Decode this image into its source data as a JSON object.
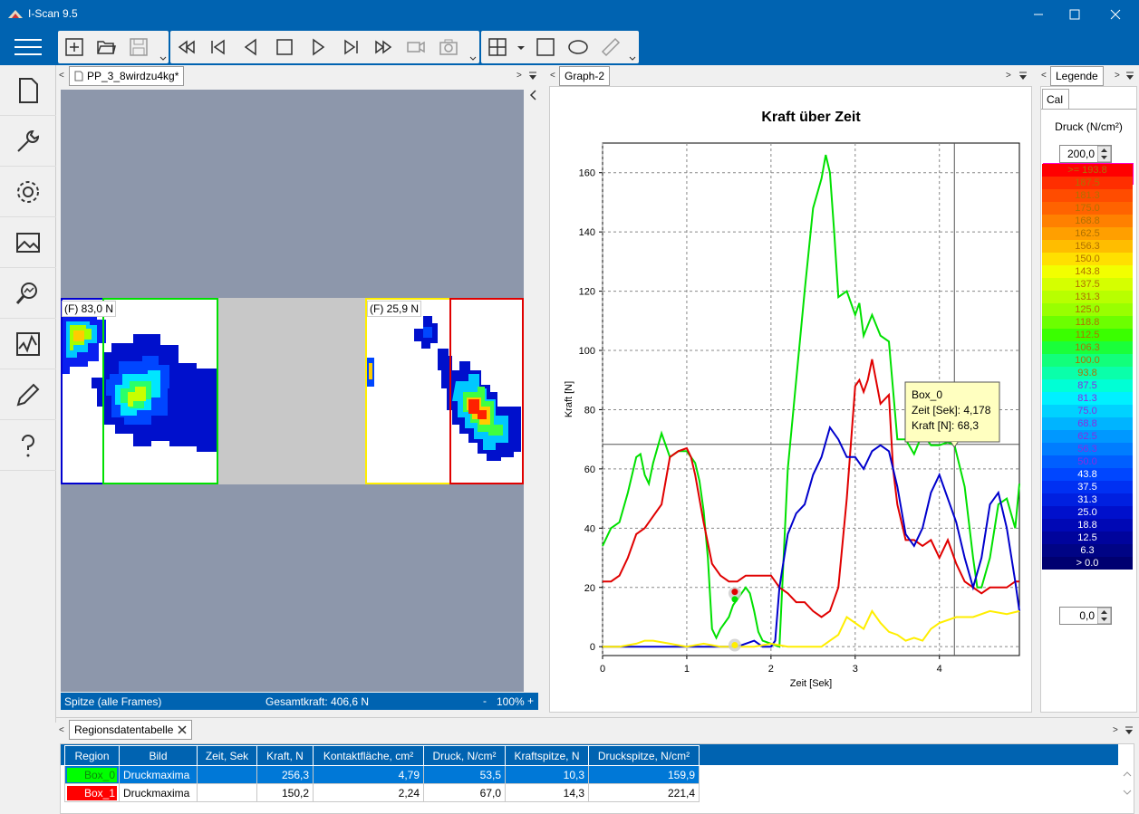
{
  "window": {
    "title": "I-Scan 9.5"
  },
  "left_panel": {
    "tab_label": "PP_3_8wirdzu4kg*",
    "region_left_label": "(F) 83,0 N",
    "region_right_label": "(F) 25,9 N",
    "status_left": "Spitze (alle Frames)",
    "status_center": "Gesamtkraft: 406,6 N",
    "zoom_minus": "-",
    "zoom": "100%",
    "zoom_plus": "+"
  },
  "graph_panel": {
    "tab_label": "Graph-2"
  },
  "legend_panel": {
    "tab_label": "Legende",
    "cal_tab": "Cal",
    "unit_label": "Druck (N/cm²)",
    "max_value": "200,0",
    "min_value": "0,0",
    "scale": [
      {
        "label": ">= 193.8",
        "color": "#ff0000"
      },
      {
        "label": "187.5",
        "color": "#ff2e00"
      },
      {
        "label": "181.3",
        "color": "#ff4c00"
      },
      {
        "label": "175.0",
        "color": "#ff6300"
      },
      {
        "label": "168.8",
        "color": "#ff8000"
      },
      {
        "label": "162.5",
        "color": "#ff9f00"
      },
      {
        "label": "156.3",
        "color": "#ffbd00"
      },
      {
        "label": "150.0",
        "color": "#ffe000"
      },
      {
        "label": "143.8",
        "color": "#f2ff00"
      },
      {
        "label": "137.5",
        "color": "#d5ff00"
      },
      {
        "label": "131.3",
        "color": "#b8ff00"
      },
      {
        "label": "125.0",
        "color": "#99ff00"
      },
      {
        "label": "118.8",
        "color": "#6cff00"
      },
      {
        "label": "112.5",
        "color": "#3aff00"
      },
      {
        "label": "106.3",
        "color": "#1aff3a"
      },
      {
        "label": "100.0",
        "color": "#12ff7b"
      },
      {
        "label": "93.8",
        "color": "#0affaa"
      },
      {
        "label": "87.5",
        "color": "#00ffd5"
      },
      {
        "label": "81.3",
        "color": "#00f0ff"
      },
      {
        "label": "75.0",
        "color": "#00d2ff"
      },
      {
        "label": "68.8",
        "color": "#00b4ff"
      },
      {
        "label": "62.5",
        "color": "#0098ff"
      },
      {
        "label": "56.3",
        "color": "#007dff"
      },
      {
        "label": "50.0",
        "color": "#005fff"
      },
      {
        "label": "43.8",
        "color": "#0046ff"
      },
      {
        "label": "37.5",
        "color": "#0030f2"
      },
      {
        "label": "31.3",
        "color": "#0020e0"
      },
      {
        "label": "25.0",
        "color": "#0010cc"
      },
      {
        "label": "18.8",
        "color": "#0008b5"
      },
      {
        "label": "12.5",
        "color": "#00049c"
      },
      {
        "label": "6.3",
        "color": "#000485"
      },
      {
        "label": "> 0.0",
        "color": "#000070"
      }
    ]
  },
  "region_table": {
    "tab_label": "Regionsdatentabelle",
    "headers": [
      "Region",
      "Bild",
      "Zeit, Sek",
      "Kraft, N",
      "Kontaktfläche, cm²",
      "Druck, N/cm²",
      "Kraftspitze, N",
      "Druckspitze, N/cm²"
    ],
    "rows": [
      {
        "region": "Box_0",
        "color": "#00ff00",
        "bild": "Druckmaxima",
        "zeit": "",
        "kraft": "256,3",
        "flaeche": "4,79",
        "druck": "53,5",
        "kraftspitze": "10,3",
        "druckspitze": "159,9"
      },
      {
        "region": "Box_1",
        "color": "#ff0000",
        "bild": "Druckmaxima",
        "zeit": "",
        "kraft": "150,2",
        "flaeche": "2,24",
        "druck": "67,0",
        "kraftspitze": "14,3",
        "druckspitze": "221,4"
      }
    ]
  },
  "chart_data": {
    "type": "line",
    "title": "Kraft über Zeit",
    "xlabel": "Zeit [Sek]",
    "ylabel": "Kraft [N]",
    "xlim": [
      0,
      4.95
    ],
    "ylim": [
      -3,
      170
    ],
    "xticks": [
      "0",
      "1",
      "2",
      "3",
      "4"
    ],
    "yticks": [
      "0",
      "20",
      "40",
      "60",
      "80",
      "100",
      "120",
      "140",
      "160"
    ],
    "grid": true,
    "crosshair": {
      "x": 4.178,
      "y": 68.3
    },
    "tooltip": {
      "line1": "Box_0",
      "line2": "Zeit [Sek]: 4,178",
      "line3": "Kraft [N]: 68,3"
    },
    "series": [
      {
        "color": "#00e000",
        "x": [
          0,
          0.1,
          0.2,
          0.3,
          0.4,
          0.45,
          0.5,
          0.55,
          0.6,
          0.7,
          0.75,
          0.8,
          0.9,
          1.0,
          1.1,
          1.15,
          1.2,
          1.25,
          1.3,
          1.35,
          1.4,
          1.5,
          1.55,
          1.6,
          1.7,
          1.75,
          1.8,
          1.85,
          1.9,
          2.0,
          2.1,
          2.2,
          2.3,
          2.4,
          2.5,
          2.6,
          2.65,
          2.7,
          2.75,
          2.8,
          2.9,
          3.0,
          3.05,
          3.1,
          3.2,
          3.3,
          3.4,
          3.5,
          3.6,
          3.7,
          3.8,
          3.9,
          4.0,
          4.1,
          4.18,
          4.3,
          4.4,
          4.45,
          4.5,
          4.6,
          4.7,
          4.8,
          4.9,
          4.95
        ],
        "y": [
          34,
          40,
          42,
          52,
          64,
          65,
          58,
          55,
          62,
          72,
          68,
          64,
          66,
          66,
          62,
          56,
          46,
          30,
          6,
          3,
          6,
          10,
          14,
          16,
          20,
          18,
          12,
          5,
          2,
          1,
          0,
          60,
          90,
          120,
          148,
          158,
          166,
          160,
          140,
          118,
          120,
          112,
          116,
          105,
          112,
          105,
          103,
          70,
          70,
          65,
          72,
          68,
          68,
          69,
          68,
          54,
          30,
          20,
          20,
          30,
          48,
          50,
          40,
          55
        ]
      },
      {
        "color": "#e00000",
        "x": [
          0,
          0.1,
          0.2,
          0.3,
          0.4,
          0.5,
          0.6,
          0.7,
          0.8,
          0.9,
          1.0,
          1.05,
          1.1,
          1.2,
          1.3,
          1.4,
          1.5,
          1.6,
          1.7,
          1.8,
          1.9,
          2.0,
          2.1,
          2.2,
          2.3,
          2.4,
          2.5,
          2.6,
          2.7,
          2.8,
          2.9,
          3.0,
          3.05,
          3.1,
          3.15,
          3.2,
          3.3,
          3.4,
          3.45,
          3.5,
          3.6,
          3.7,
          3.8,
          3.9,
          4.0,
          4.1,
          4.2,
          4.3,
          4.4,
          4.5,
          4.6,
          4.7,
          4.8,
          4.9,
          4.95
        ],
        "y": [
          22,
          22,
          24,
          30,
          38,
          40,
          44,
          48,
          64,
          66,
          67,
          64,
          58,
          42,
          28,
          24,
          22,
          22,
          24,
          24,
          24,
          24,
          20,
          18,
          15,
          15,
          12,
          10,
          12,
          20,
          50,
          88,
          90,
          86,
          90,
          97,
          82,
          85,
          60,
          48,
          36,
          36,
          34,
          36,
          30,
          36,
          28,
          22,
          20,
          18,
          20,
          20,
          20,
          22,
          22
        ]
      },
      {
        "color": "#0000cc",
        "x": [
          0,
          0.2,
          0.4,
          0.6,
          0.8,
          1.0,
          1.2,
          1.4,
          1.6,
          1.8,
          1.9,
          2.0,
          2.05,
          2.1,
          2.2,
          2.3,
          2.4,
          2.5,
          2.6,
          2.7,
          2.8,
          2.9,
          3.0,
          3.1,
          3.2,
          3.3,
          3.4,
          3.5,
          3.6,
          3.7,
          3.8,
          3.9,
          4.0,
          4.1,
          4.2,
          4.3,
          4.4,
          4.5,
          4.6,
          4.7,
          4.8,
          4.9,
          4.95
        ],
        "y": [
          0,
          0,
          0,
          0,
          0,
          0,
          0,
          0,
          0,
          2,
          0,
          0,
          2,
          20,
          38,
          45,
          48,
          58,
          64,
          74,
          70,
          64,
          64,
          60,
          66,
          68,
          66,
          54,
          38,
          34,
          40,
          52,
          58,
          50,
          42,
          30,
          20,
          30,
          48,
          52,
          40,
          22,
          12
        ]
      },
      {
        "color": "#ffee00",
        "x": [
          0,
          0.2,
          0.4,
          0.5,
          0.6,
          0.8,
          1.0,
          1.2,
          1.4,
          1.6,
          1.8,
          2.0,
          2.2,
          2.4,
          2.6,
          2.7,
          2.8,
          2.9,
          3.0,
          3.1,
          3.2,
          3.3,
          3.4,
          3.5,
          3.6,
          3.7,
          3.8,
          3.9,
          4.0,
          4.2,
          4.4,
          4.6,
          4.8,
          4.95
        ],
        "y": [
          0,
          0,
          1,
          2,
          2,
          1,
          0,
          1,
          0,
          0,
          0,
          1,
          0,
          0,
          0,
          2,
          4,
          10,
          8,
          6,
          12,
          8,
          5,
          4,
          2,
          3,
          2,
          6,
          8,
          10,
          10,
          12,
          11,
          12
        ]
      }
    ]
  }
}
